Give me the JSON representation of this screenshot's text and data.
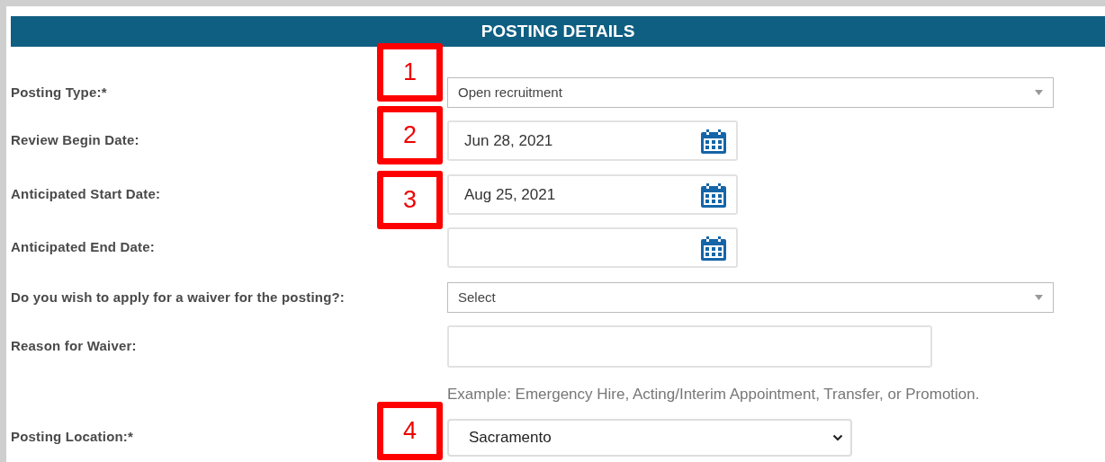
{
  "section": {
    "title": "POSTING DETAILS"
  },
  "fields": [
    {
      "kind": "select",
      "label": "Posting Type:*",
      "value": "Open recruitment",
      "callout": "1"
    },
    {
      "kind": "date",
      "label": "Review Begin Date:",
      "value": "Jun 28, 2021",
      "callout": "2"
    },
    {
      "kind": "date",
      "label": "Anticipated Start Date:",
      "value": "Aug 25, 2021",
      "callout": "3"
    },
    {
      "kind": "date",
      "label": "Anticipated End Date:"
    },
    {
      "kind": "select",
      "label": "Do you wish to apply for a waiver for the posting?:",
      "value": "Select"
    },
    {
      "kind": "text",
      "label": "Reason for Waiver:",
      "hint": "Example: Emergency Hire, Acting/Interim Appointment, Transfer, or Promotion."
    },
    {
      "kind": "native-select",
      "label": "Posting Location:*",
      "value": "Sacramento",
      "callout": "4"
    }
  ]
}
